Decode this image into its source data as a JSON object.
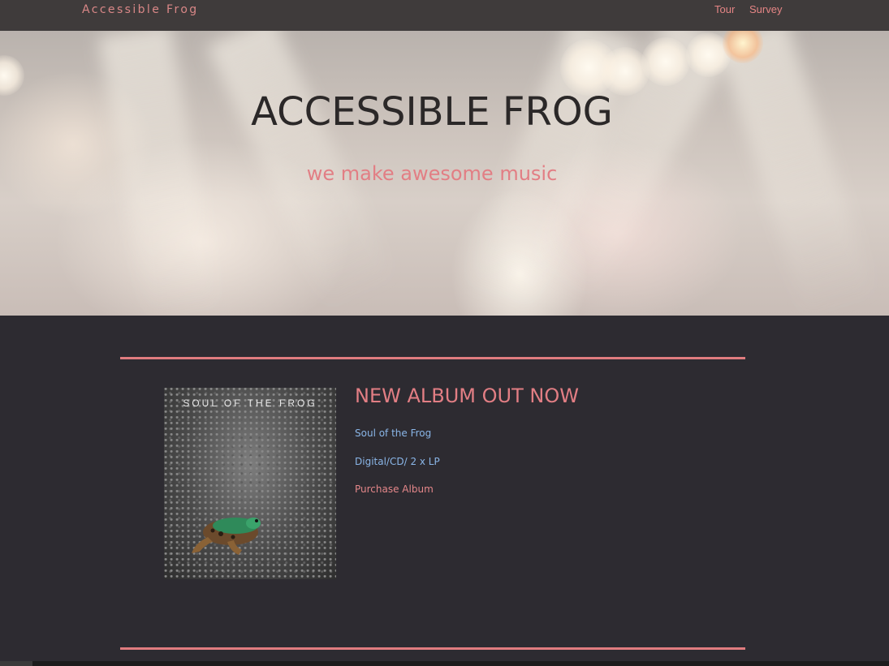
{
  "nav": {
    "brand": "Accessible Frog",
    "links": [
      {
        "label": "Tour"
      },
      {
        "label": "Survey"
      }
    ]
  },
  "hero": {
    "title": "ACCESSIBLE FROG",
    "subtitle": "we make awesome music"
  },
  "album": {
    "cover_caption": "SOUL OF THE FROG",
    "heading": "NEW ALBUM OUT NOW",
    "name": "Soul of the Frog",
    "formats": "Digital/CD/ 2 x LP",
    "purchase": "Purchase Album"
  },
  "colors": {
    "accent": "#e07c7f",
    "link": "#8ab6e8",
    "background": "#2d2b31",
    "navbar": "#3f3b3b"
  }
}
